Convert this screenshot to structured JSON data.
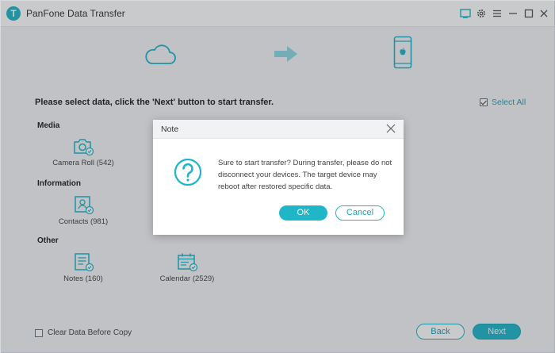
{
  "app": {
    "title": "PanFone Data Transfer",
    "logo_letter": "T"
  },
  "content": {
    "instruction": "Please select data, click the 'Next' button to start transfer.",
    "select_all": "Select All",
    "sections": [
      {
        "title": "Media",
        "items": [
          {
            "label": "Camera Roll (542)"
          }
        ]
      },
      {
        "title": "Information",
        "items": [
          {
            "label": "Contacts (981)"
          }
        ]
      },
      {
        "title": "Other",
        "items": [
          {
            "label": "Notes (160)"
          },
          {
            "label": "Calendar (2529)"
          }
        ]
      }
    ],
    "clear_data": "Clear Data Before Copy"
  },
  "footer": {
    "back_label": "Back",
    "next_label": "Next"
  },
  "dialog": {
    "title": "Note",
    "message": "Sure to start transfer? During transfer, please do not disconnect your devices. The target device may reboot after restored specific data.",
    "ok_label": "OK",
    "cancel_label": "Cancel"
  },
  "colors": {
    "accent": "#1fb6c8",
    "overlay": "rgba(40,44,52,0.25)"
  }
}
